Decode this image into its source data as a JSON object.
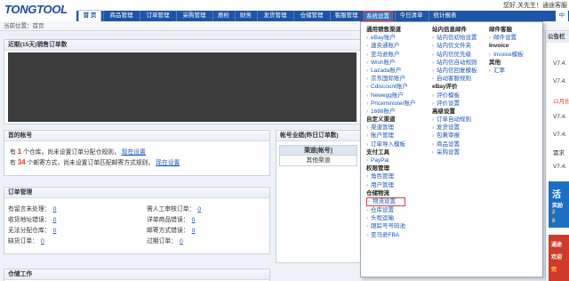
{
  "header": {
    "logo": "TONGTOOL",
    "user_text": "您好,关先生！通途客服",
    "nav": [
      "首 页",
      "商品管理",
      "订单管理",
      "采购管理",
      "质检",
      "财务",
      "发货管理",
      "仓储管理",
      "客服管理",
      "系统设置",
      "今日清单",
      "统计报表"
    ],
    "right_button": "中"
  },
  "breadcrumb": "当前位置：首页",
  "sales_panel": {
    "title": "近期(15天)销售订单数"
  },
  "accounts_panel": {
    "title": "首的帐号",
    "line1": {
      "pre": "有",
      "count": "1",
      "mid": "个仓库，尚未设置订单分配仓规则，",
      "link": "现在设置"
    },
    "line2": {
      "pre": "有",
      "count": "34",
      "mid": "个邮寄方式，尚未设置订单匹配邮寄方式规则，",
      "link": "现在设置"
    }
  },
  "account_sales_panel": {
    "title": "帐号业绩(昨日订单数)",
    "col_channel": "渠道[帐号]",
    "row_other": "其他渠道"
  },
  "orders_panel": {
    "title": "订单管理",
    "items": [
      {
        "label": "有留言未处理：",
        "value": "0"
      },
      {
        "label": "需人工审核订单：",
        "value": "0"
      },
      {
        "label": "收货地址错误：",
        "value": "0"
      },
      {
        "label": "详单商品错误：",
        "value": "0"
      },
      {
        "label": "无法分配仓库：",
        "value": "0"
      },
      {
        "label": "邮寄方式错误：",
        "value": "0"
      },
      {
        "label": "缺货订单：",
        "value": "0"
      },
      {
        "label": "过期订单：",
        "value": "0"
      }
    ]
  },
  "warehouse_panel": {
    "title": "仓储工作"
  },
  "dropdown": {
    "col1": [
      {
        "t": "通用销售渠道",
        "k": "sec"
      },
      {
        "t": "eBay账户",
        "k": "item"
      },
      {
        "t": "速卖通账户",
        "k": "item"
      },
      {
        "t": "亚马逊账户",
        "k": "item"
      },
      {
        "t": "Wish账户",
        "k": "item"
      },
      {
        "t": "Lazada账户",
        "k": "item"
      },
      {
        "t": "京东国际账户",
        "k": "item"
      },
      {
        "t": "Cdiscount账户",
        "k": "item"
      },
      {
        "t": "Newegg账户",
        "k": "item"
      },
      {
        "t": "Priceminister账户",
        "k": "item"
      },
      {
        "t": "1688账户",
        "k": "item"
      },
      {
        "t": "自定义渠道",
        "k": "sec"
      },
      {
        "t": "渠道管理",
        "k": "item"
      },
      {
        "t": "账户管理",
        "k": "item"
      },
      {
        "t": "订单导入模板",
        "k": "item"
      },
      {
        "t": "支付工具",
        "k": "sec"
      },
      {
        "t": "PayPal",
        "k": "item"
      },
      {
        "t": "权限管理",
        "k": "sec"
      },
      {
        "t": "角色管理",
        "k": "item"
      },
      {
        "t": "用户管理",
        "k": "item"
      },
      {
        "t": "仓储物流",
        "k": "sec"
      },
      {
        "t": "物流设置",
        "k": "item hl"
      },
      {
        "t": "仓库设置",
        "k": "item"
      },
      {
        "t": "头程运输",
        "k": "item"
      },
      {
        "t": "跟踪号号码池",
        "k": "item"
      },
      {
        "t": "亚马逊FBA",
        "k": "item"
      }
    ],
    "col2": [
      {
        "t": "站内信息邮件",
        "k": "sec"
      },
      {
        "t": "站内信初始设置",
        "k": "item"
      },
      {
        "t": "站内信文件夹",
        "k": "item"
      },
      {
        "t": "站内信优先级",
        "k": "item"
      },
      {
        "t": "站内信自动规则",
        "k": "item"
      },
      {
        "t": "站内信回复模板",
        "k": "item"
      },
      {
        "t": "自动客服规则",
        "k": "item"
      },
      {
        "t": "eBay评价",
        "k": "sec"
      },
      {
        "t": "评价模板",
        "k": "item"
      },
      {
        "t": "评价设置",
        "k": "item"
      },
      {
        "t": "高级设置",
        "k": "sec"
      },
      {
        "t": "订单自动规则",
        "k": "item"
      },
      {
        "t": "发货设置",
        "k": "item"
      },
      {
        "t": "包裹审报",
        "k": "item"
      },
      {
        "t": "商品设置",
        "k": "item"
      },
      {
        "t": "采购设置",
        "k": "item"
      }
    ],
    "col3": [
      {
        "t": "邮件客服",
        "k": "sec"
      },
      {
        "t": "邮件设置",
        "k": "item"
      },
      {
        "t": "Invoice",
        "k": "sec"
      },
      {
        "t": "Invoice模板",
        "k": "item"
      },
      {
        "t": "其他",
        "k": "sec"
      },
      {
        "t": "汇率",
        "k": "item"
      }
    ]
  },
  "right_col": {
    "title": "公告栏",
    "items": [
      "V7.4.",
      "V7.4.",
      "11月份",
      "V7.4.",
      "V7.4.",
      "需求",
      "V7.4."
    ],
    "promo1": [
      "活",
      "奖励",
      "2",
      "8"
    ],
    "promo2": [
      "通途",
      "欢迎",
      "完"
    ]
  }
}
